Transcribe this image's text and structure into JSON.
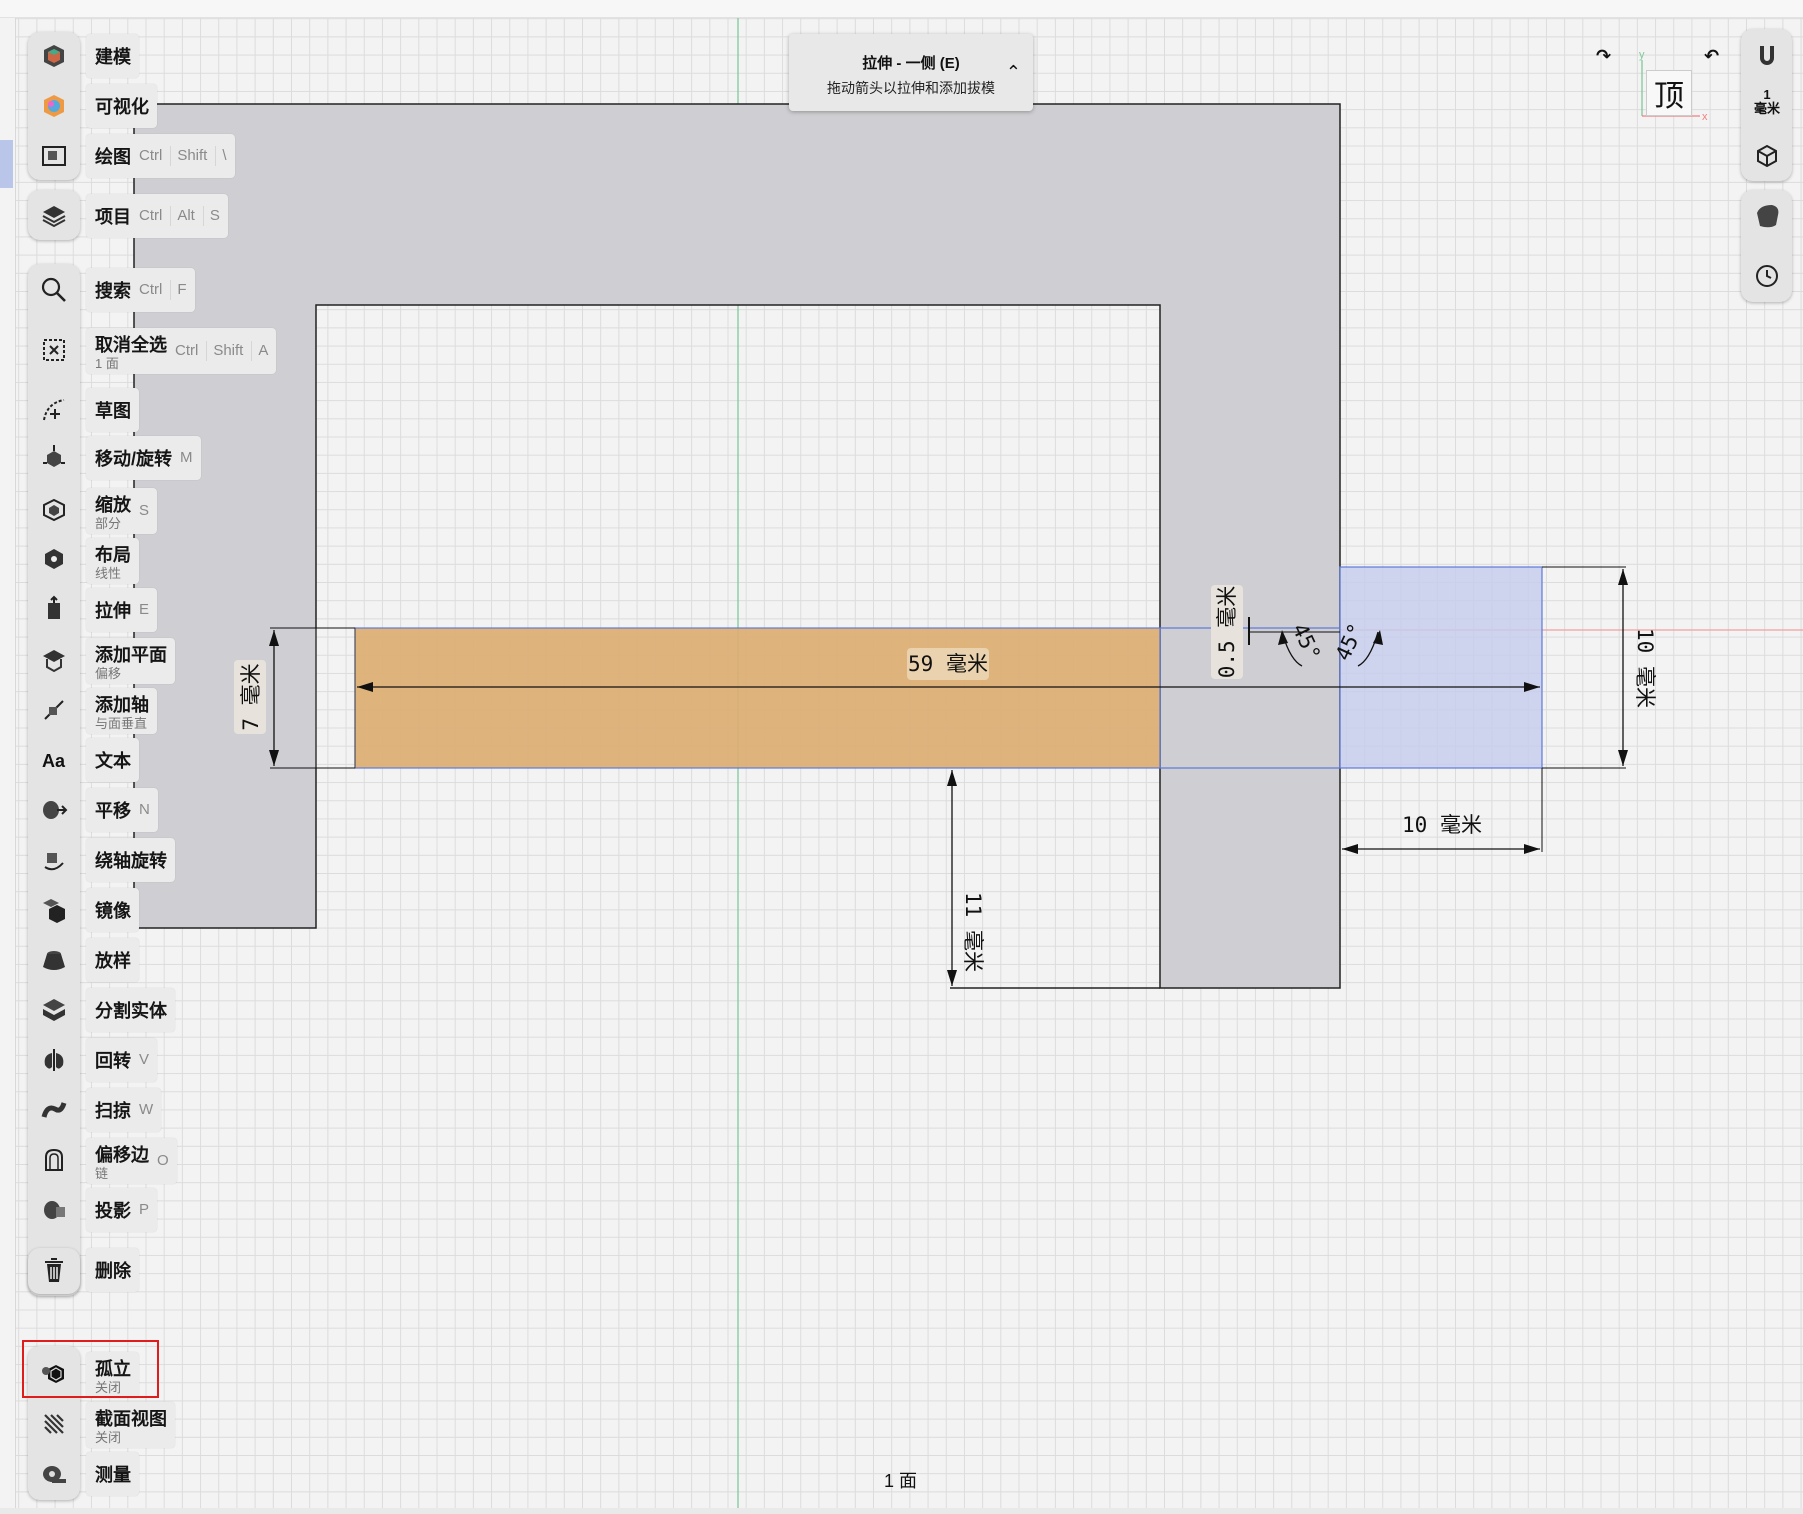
{
  "hint": {
    "title": "拉伸 - 一侧 (E)",
    "subtitle": "拖动箭头以拉伸和添加拔模"
  },
  "view": {
    "orientation": "顶",
    "scale_value": "1",
    "scale_unit": "毫米"
  },
  "status": {
    "selection": "1 面"
  },
  "dimensions": {
    "length": "59 毫米",
    "height": "7 毫米",
    "offset": "11 毫米",
    "width": "10 毫米",
    "depth": "10 毫米",
    "gap": "0.5 毫米",
    "angle_left": "45°",
    "angle_right": "45°"
  },
  "colors": {
    "extrude_face": "#dcae72",
    "selection": "#c7cdec",
    "body": "#cfcfd3"
  },
  "tools": [
    {
      "label": "建模",
      "sub": "",
      "keys": [],
      "icon": "modeling-icon"
    },
    {
      "label": "可视化",
      "sub": "",
      "keys": [],
      "icon": "visualize-icon"
    },
    {
      "label": "绘图",
      "sub": "",
      "keys": [
        "Ctrl",
        "Shift",
        "\\"
      ],
      "icon": "drawing-icon"
    },
    {
      "label": "项目",
      "sub": "",
      "keys": [
        "Ctrl",
        "Alt",
        "S"
      ],
      "icon": "project-layers-icon"
    },
    {
      "label": "搜索",
      "sub": "",
      "keys": [
        "Ctrl",
        "F"
      ],
      "icon": "search-icon"
    },
    {
      "label": "取消全选",
      "sub": "1 面",
      "keys": [
        "Ctrl",
        "Shift",
        "A"
      ],
      "icon": "deselect-icon"
    },
    {
      "label": "草图",
      "sub": "",
      "keys": [],
      "icon": "sketch-icon"
    },
    {
      "label": "移动/旋转",
      "sub": "",
      "keys": [
        "M"
      ],
      "icon": "move-rotate-icon"
    },
    {
      "label": "缩放",
      "sub": "部分",
      "keys": [
        "S"
      ],
      "icon": "scale-icon"
    },
    {
      "label": "布局",
      "sub": "线性",
      "keys": [],
      "icon": "pattern-icon"
    },
    {
      "label": "拉伸",
      "sub": "",
      "keys": [
        "E"
      ],
      "icon": "extrude-icon"
    },
    {
      "label": "添加平面",
      "sub": "偏移",
      "keys": [],
      "icon": "add-plane-icon"
    },
    {
      "label": "添加轴",
      "sub": "与面垂直",
      "keys": [],
      "icon": "add-axis-icon"
    },
    {
      "label": "文本",
      "sub": "",
      "keys": [],
      "icon": "text-icon"
    },
    {
      "label": "平移",
      "sub": "",
      "keys": [
        "N"
      ],
      "icon": "translate-icon"
    },
    {
      "label": "绕轴旋转",
      "sub": "",
      "keys": [],
      "icon": "rotate-axis-icon"
    },
    {
      "label": "镜像",
      "sub": "",
      "keys": [],
      "icon": "mirror-icon"
    },
    {
      "label": "放样",
      "sub": "",
      "keys": [],
      "icon": "loft-icon"
    },
    {
      "label": "分割实体",
      "sub": "",
      "keys": [],
      "icon": "split-body-icon"
    },
    {
      "label": "回转",
      "sub": "",
      "keys": [
        "V"
      ],
      "icon": "revolve-icon"
    },
    {
      "label": "扫掠",
      "sub": "",
      "keys": [
        "W"
      ],
      "icon": "sweep-icon"
    },
    {
      "label": "偏移边",
      "sub": "链",
      "keys": [
        "O"
      ],
      "icon": "offset-edge-icon"
    },
    {
      "label": "投影",
      "sub": "",
      "keys": [
        "P"
      ],
      "icon": "project-icon"
    },
    {
      "label": "删除",
      "sub": "",
      "keys": [],
      "icon": "trash-icon"
    },
    {
      "label": "孤立",
      "sub": "关闭",
      "keys": [],
      "icon": "isolate-icon"
    },
    {
      "label": "截面视图",
      "sub": "关闭",
      "keys": [],
      "icon": "section-view-icon"
    },
    {
      "label": "测量",
      "sub": "",
      "keys": [],
      "icon": "measure-icon"
    }
  ]
}
